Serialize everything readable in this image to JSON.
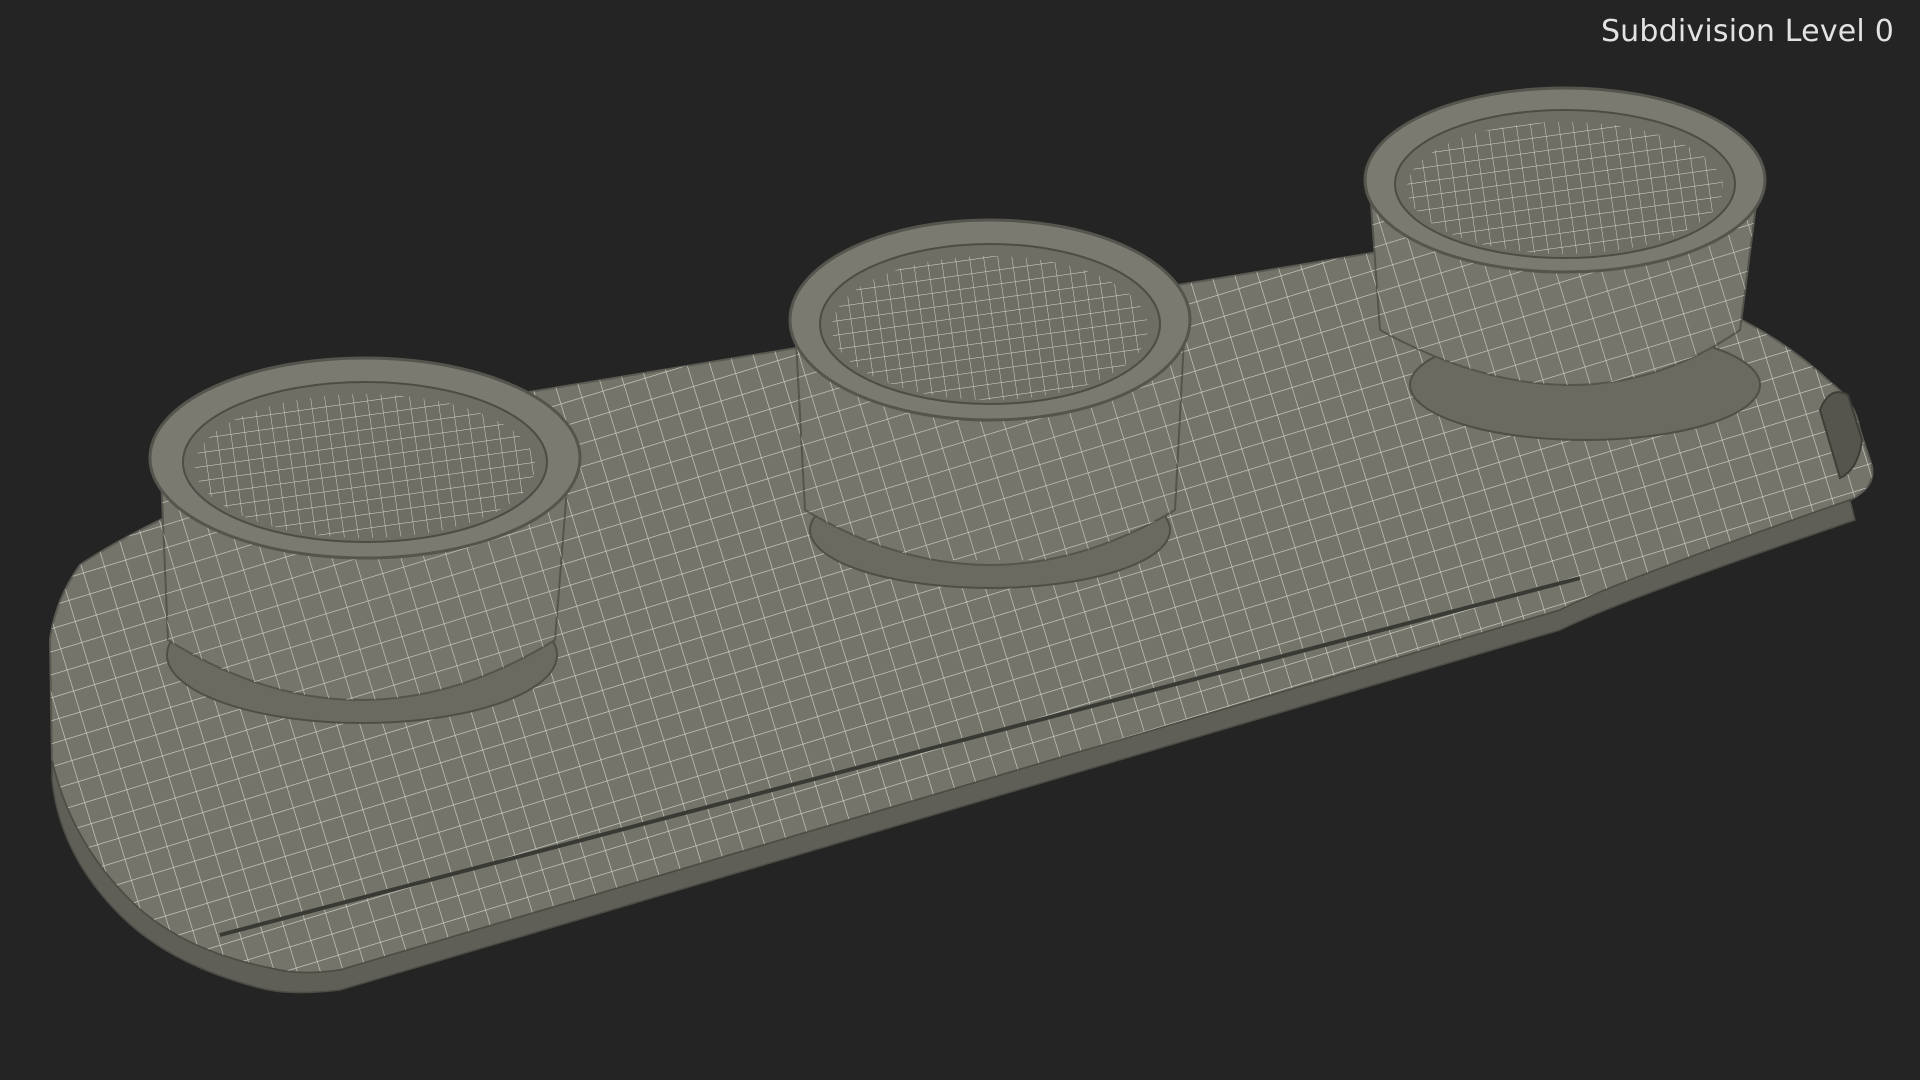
{
  "viewport": {
    "label": "Subdivision Level 0",
    "background_color": "#242424",
    "surface_color": "#74746a",
    "wire_color": "#e6e6de"
  }
}
